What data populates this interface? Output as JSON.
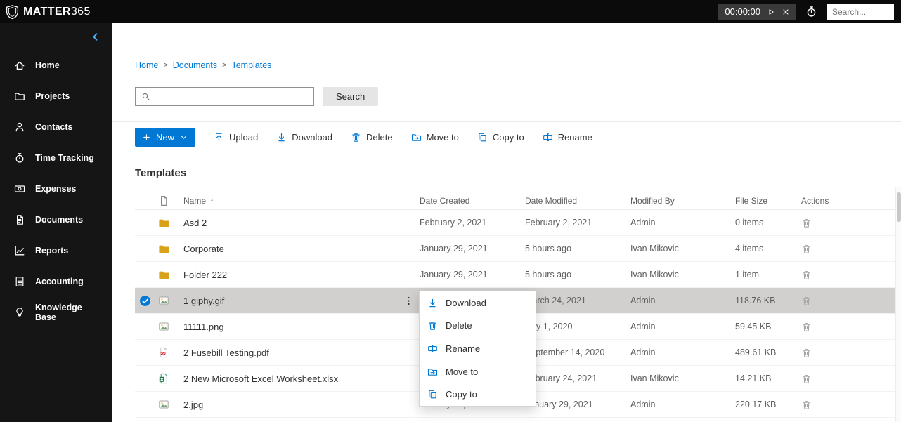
{
  "topbar": {
    "brand_bold": "MATTER",
    "brand_light": "365",
    "timer_value": "00:00:00",
    "search_placeholder": "Search..."
  },
  "sidebar": {
    "items": [
      {
        "label": "Home"
      },
      {
        "label": "Projects"
      },
      {
        "label": "Contacts"
      },
      {
        "label": "Time Tracking"
      },
      {
        "label": "Expenses"
      },
      {
        "label": "Documents"
      },
      {
        "label": "Reports"
      },
      {
        "label": "Accounting"
      },
      {
        "label": "Knowledge Base"
      }
    ]
  },
  "breadcrumb": {
    "separator": ">",
    "items": [
      "Home",
      "Documents",
      "Templates"
    ]
  },
  "filter": {
    "search_value": "",
    "search_button": "Search"
  },
  "toolbar": {
    "new_label": "New",
    "commands": [
      {
        "label": "Upload"
      },
      {
        "label": "Download"
      },
      {
        "label": "Delete"
      },
      {
        "label": "Move to"
      },
      {
        "label": "Copy to"
      },
      {
        "label": "Rename"
      }
    ]
  },
  "section_title": "Templates",
  "table": {
    "headers": {
      "name": "Name",
      "sort_indicator": "↑",
      "date_created": "Date Created",
      "date_modified": "Date Modified",
      "modified_by": "Modified By",
      "file_size": "File Size",
      "actions": "Actions"
    },
    "rows": [
      {
        "type": "folder",
        "name": "Asd 2",
        "date_created": "February 2, 2021",
        "date_modified": "February 2, 2021",
        "modified_by": "Admin",
        "file_size": "0 items",
        "selected": false
      },
      {
        "type": "folder",
        "name": "Corporate",
        "date_created": "January 29, 2021",
        "date_modified": "5 hours ago",
        "modified_by": "Ivan Mikovic",
        "file_size": "4 items",
        "selected": false
      },
      {
        "type": "folder",
        "name": "Folder 222",
        "date_created": "January 29, 2021",
        "date_modified": "5 hours ago",
        "modified_by": "Ivan Mikovic",
        "file_size": "1 item",
        "selected": false
      },
      {
        "type": "image",
        "name": "1 giphy.gif",
        "date_created": "",
        "date_modified": "March 24, 2021",
        "modified_by": "Admin",
        "file_size": "118.76 KB",
        "selected": true
      },
      {
        "type": "image",
        "name": "11111.png",
        "date_created": "",
        "date_modified": "July 1, 2020",
        "modified_by": "Admin",
        "file_size": "59.45 KB",
        "selected": false
      },
      {
        "type": "pdf",
        "name": "2 Fusebill Testing.pdf",
        "date_created": "",
        "date_modified": "September 14, 2020",
        "modified_by": "Admin",
        "file_size": "489.61 KB",
        "selected": false
      },
      {
        "type": "excel",
        "name": "2 New Microsoft Excel Worksheet.xlsx",
        "date_created": "",
        "date_modified": "February 24, 2021",
        "modified_by": "Ivan Mikovic",
        "file_size": "14.21 KB",
        "selected": false
      },
      {
        "type": "image",
        "name": "2.jpg",
        "date_created": "January 29, 2021",
        "date_modified": "January 29, 2021",
        "modified_by": "Admin",
        "file_size": "220.17 KB",
        "selected": false
      }
    ]
  },
  "context_menu": {
    "items": [
      {
        "label": "Download"
      },
      {
        "label": "Delete"
      },
      {
        "label": "Rename"
      },
      {
        "label": "Move to"
      },
      {
        "label": "Copy to"
      }
    ]
  },
  "colors": {
    "accent": "#0078d4",
    "selected_row": "#d2d0ce",
    "folder": "#d9a118"
  }
}
